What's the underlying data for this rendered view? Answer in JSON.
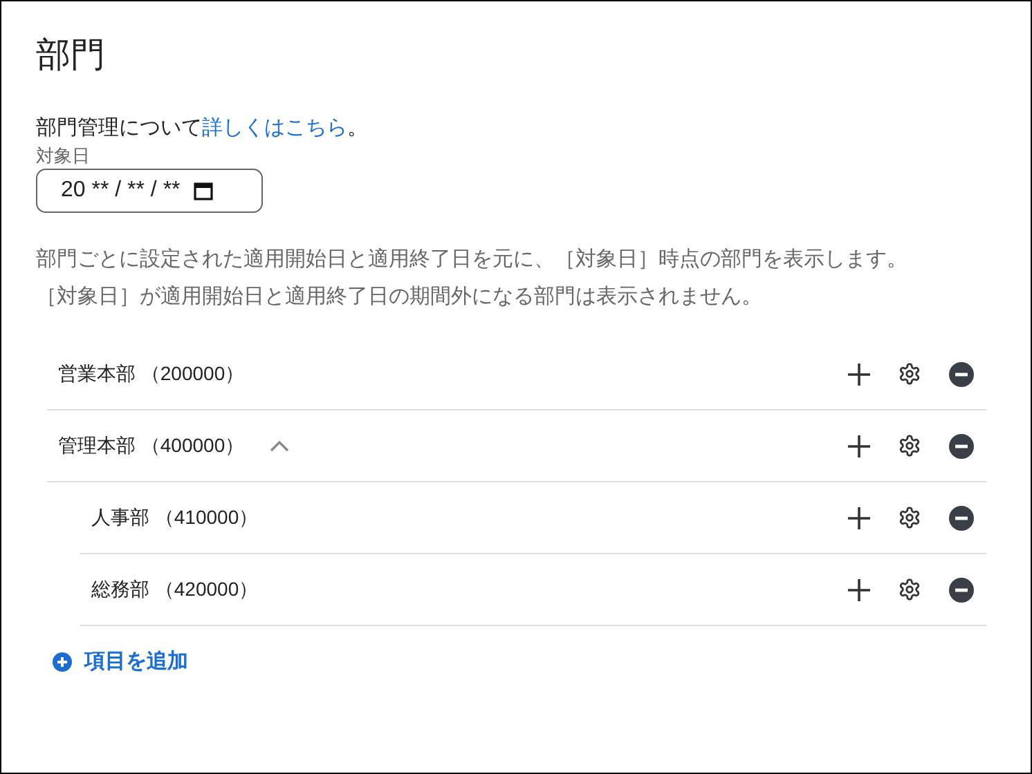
{
  "title": "部門",
  "intro": {
    "text": "部門管理について",
    "link": "詳しくはこちら",
    "tail": "。"
  },
  "date_field": {
    "label": "対象日",
    "value": "20 ** / ** / **"
  },
  "description": [
    "部門ごとに設定された適用開始日と適用終了日を元に、［対象日］時点の部門を表示します。",
    "［対象日］が適用開始日と適用終了日の期間外になる部門は表示されません。"
  ],
  "departments": [
    {
      "name": "営業本部 （200000）"
    },
    {
      "name": "管理本部 （400000）",
      "expanded": true,
      "children": [
        {
          "name": "人事部 （410000）"
        },
        {
          "name": "総務部 （420000）"
        }
      ]
    }
  ],
  "add_button": "項目を追加"
}
